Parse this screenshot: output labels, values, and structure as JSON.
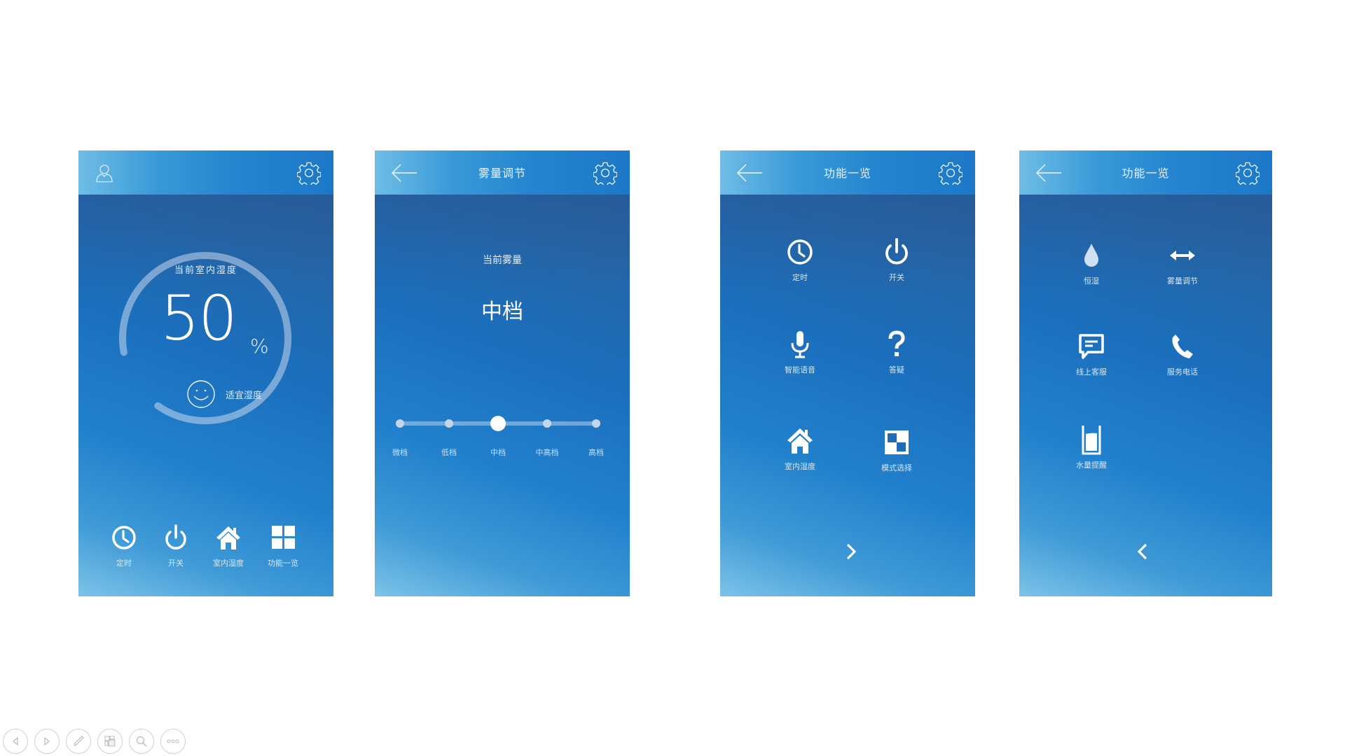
{
  "screens": {
    "home": {
      "humidity_title": "当前室内湿度",
      "humidity_value": "50",
      "humidity_unit": "%",
      "humidity_percent": 50,
      "status_text": "适宜湿度",
      "nav": [
        {
          "label": "定时",
          "icon": "clock-icon"
        },
        {
          "label": "开关",
          "icon": "power-icon"
        },
        {
          "label": "室内湿度",
          "icon": "home-icon"
        },
        {
          "label": "功能一览",
          "icon": "grid-icon"
        }
      ]
    },
    "mist": {
      "title": "雾量调节",
      "current_label": "当前雾量",
      "current_value": "中档",
      "levels": [
        "微档",
        "低档",
        "中档",
        "中高档",
        "高档"
      ],
      "selected_index": 2
    },
    "features1": {
      "title": "功能一览",
      "items": [
        {
          "label": "定时",
          "icon": "clock-icon"
        },
        {
          "label": "开关",
          "icon": "power-icon"
        },
        {
          "label": "智能语音",
          "icon": "microphone-icon"
        },
        {
          "label": "答疑",
          "icon": "question-icon"
        },
        {
          "label": "室内湿度",
          "icon": "home-icon"
        },
        {
          "label": "模式选择",
          "icon": "mode-icon"
        }
      ],
      "pager": "next"
    },
    "features2": {
      "title": "功能一览",
      "items": [
        {
          "label": "恒湿",
          "icon": "water-drop-icon"
        },
        {
          "label": "雾量调节",
          "icon": "double-arrow-icon"
        },
        {
          "label": "线上客服",
          "icon": "chat-icon"
        },
        {
          "label": "服务电话",
          "icon": "phone-icon"
        },
        {
          "label": "水量提醒",
          "icon": "water-glass-icon"
        }
      ],
      "pager": "previous"
    }
  },
  "colors": {
    "header_start": "#6fbde6",
    "header_end": "#1b78c7",
    "body_dark": "#2a5e9c",
    "text": "#ffffff"
  },
  "toolbar": [
    "previous-slide",
    "next-slide",
    "pen",
    "slides-overview",
    "zoom",
    "more-options"
  ]
}
